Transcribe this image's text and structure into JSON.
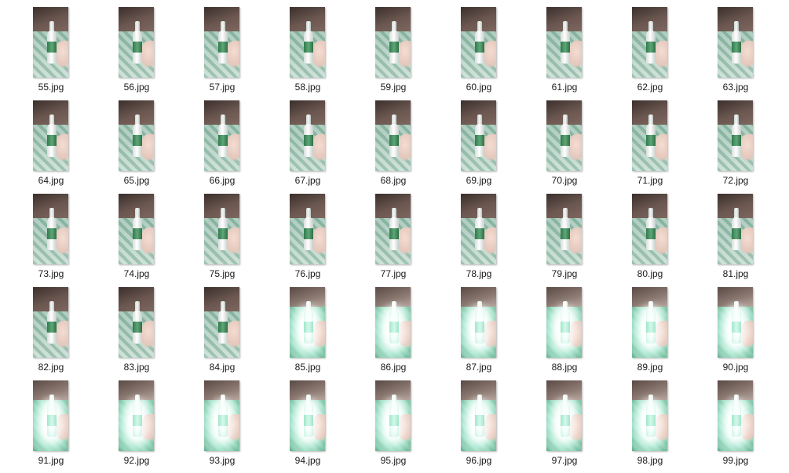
{
  "files": [
    {
      "name": "55.jpg",
      "lit": false
    },
    {
      "name": "56.jpg",
      "lit": false
    },
    {
      "name": "57.jpg",
      "lit": false
    },
    {
      "name": "58.jpg",
      "lit": false
    },
    {
      "name": "59.jpg",
      "lit": false
    },
    {
      "name": "60.jpg",
      "lit": false
    },
    {
      "name": "61.jpg",
      "lit": false
    },
    {
      "name": "62.jpg",
      "lit": false
    },
    {
      "name": "63.jpg",
      "lit": false
    },
    {
      "name": "64.jpg",
      "lit": false
    },
    {
      "name": "65.jpg",
      "lit": false
    },
    {
      "name": "66.jpg",
      "lit": false
    },
    {
      "name": "67.jpg",
      "lit": false
    },
    {
      "name": "68.jpg",
      "lit": false
    },
    {
      "name": "69.jpg",
      "lit": false
    },
    {
      "name": "70.jpg",
      "lit": false
    },
    {
      "name": "71.jpg",
      "lit": false
    },
    {
      "name": "72.jpg",
      "lit": false
    },
    {
      "name": "73.jpg",
      "lit": false
    },
    {
      "name": "74.jpg",
      "lit": false
    },
    {
      "name": "75.jpg",
      "lit": false
    },
    {
      "name": "76.jpg",
      "lit": false
    },
    {
      "name": "77.jpg",
      "lit": false
    },
    {
      "name": "78.jpg",
      "lit": false
    },
    {
      "name": "79.jpg",
      "lit": false
    },
    {
      "name": "80.jpg",
      "lit": false
    },
    {
      "name": "81.jpg",
      "lit": false
    },
    {
      "name": "82.jpg",
      "lit": false
    },
    {
      "name": "83.jpg",
      "lit": false
    },
    {
      "name": "84.jpg",
      "lit": false
    },
    {
      "name": "85.jpg",
      "lit": true
    },
    {
      "name": "86.jpg",
      "lit": true
    },
    {
      "name": "87.jpg",
      "lit": true
    },
    {
      "name": "88.jpg",
      "lit": true
    },
    {
      "name": "89.jpg",
      "lit": true
    },
    {
      "name": "90.jpg",
      "lit": true
    },
    {
      "name": "91.jpg",
      "lit": true
    },
    {
      "name": "92.jpg",
      "lit": true
    },
    {
      "name": "93.jpg",
      "lit": true
    },
    {
      "name": "94.jpg",
      "lit": true
    },
    {
      "name": "95.jpg",
      "lit": true
    },
    {
      "name": "96.jpg",
      "lit": true
    },
    {
      "name": "97.jpg",
      "lit": true
    },
    {
      "name": "98.jpg",
      "lit": true
    },
    {
      "name": "99.jpg",
      "lit": true
    }
  ],
  "thumbnail_icon": "bottle-photo-thumbnail",
  "colors": {
    "background": "#ffffff",
    "label_text": "#1a1a1a",
    "tablecloth_green": "#2f7a4c"
  }
}
